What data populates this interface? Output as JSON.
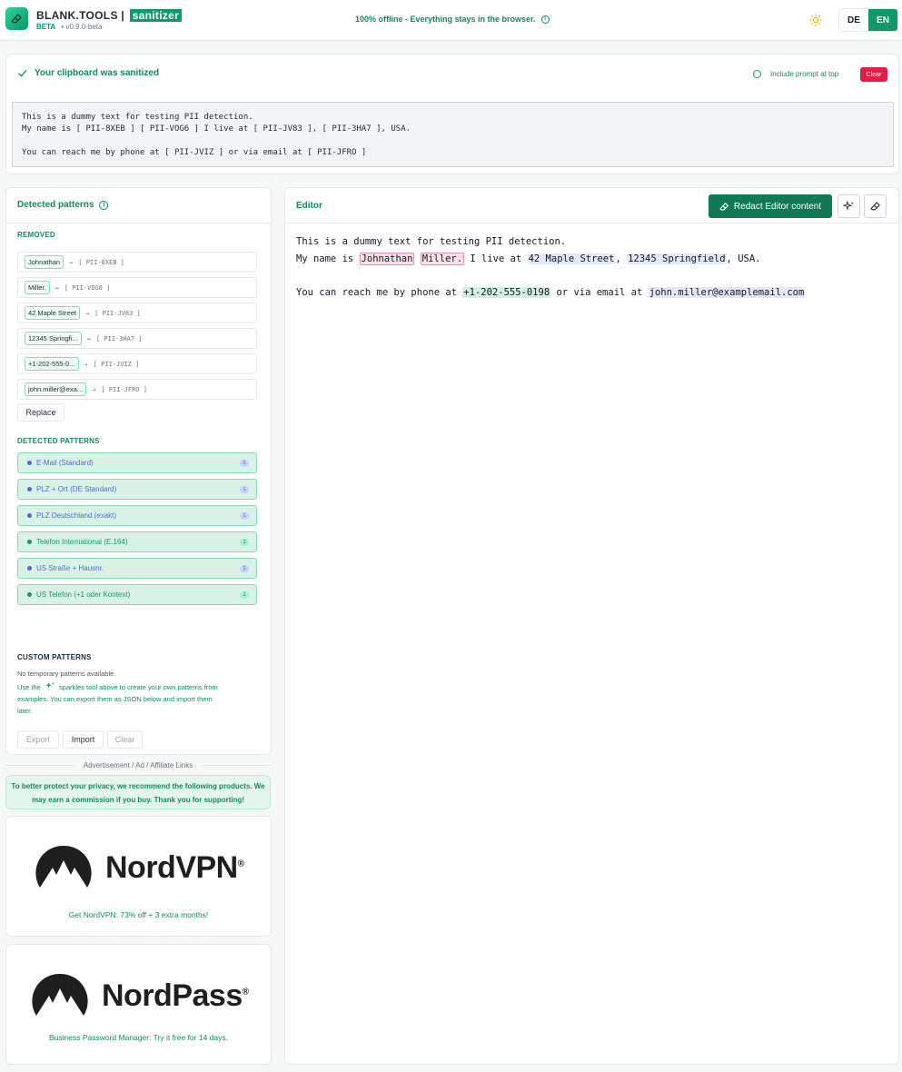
{
  "header": {
    "brand_name": "BLANK.TOOLS",
    "brand_sep": "|",
    "brand_tag": "sanitizer",
    "beta": "BETA",
    "version": "• v0.9.0-beta",
    "offline_text": "100% offline - Everything stays in the browser.",
    "lang_de": "DE",
    "lang_en": "EN",
    "active_lang": "EN",
    "icons": {
      "logo": "eraser-icon",
      "theme": "sun-icon",
      "info": "info-icon"
    }
  },
  "sanitized": {
    "title": "Your clipboard was sanitized",
    "include_prompt_label": "Include prompt at top",
    "clear_label": "Clear",
    "text": "This is a dummy text for testing PII detection.\nMy name is [ PII-8XEB ] [ PII-VOG6 ] I live at [ PII-JV83 ], [ PII-3HA7 ], USA.\n\nYou can reach me by phone at [ PII-JVIZ ] or via email at [ PII-JFRO ]"
  },
  "detected_panel": {
    "title": "Detected patterns",
    "removed_label": "REMOVED",
    "removed": [
      {
        "original": "Johnathan",
        "token": "[ PII-8XEB ]"
      },
      {
        "original": "Miller.",
        "token": "[ PII-VOG6 ]"
      },
      {
        "original": "42 Maple Street",
        "token": "[ PII-JV83 ]"
      },
      {
        "original": "12345 Springfi...",
        "token": "[ PII-3HA7 ]"
      },
      {
        "original": "+1-202-555-0...",
        "token": "[ PII-JVIZ ]"
      },
      {
        "original": "john.miller@exa...",
        "token": "[ PII-JFRO ]"
      }
    ],
    "replace_label": "Replace",
    "detected_label": "DETECTED PATTERNS",
    "patterns": [
      {
        "label": "E-Mail (Standard)",
        "count": "1",
        "color": "#4f6bd6"
      },
      {
        "label": "PLZ + Ort (DE Standard)",
        "count": "1",
        "color": "#4f6bd6"
      },
      {
        "label": "PLZ Deutschland (exakt)",
        "count": "1",
        "color": "#4f6bd6"
      },
      {
        "label": "Telefon International (E.164)",
        "count": "1",
        "color": "#10996b"
      },
      {
        "label": "US Straße + Hausnr.",
        "count": "1",
        "color": "#4f6bd6"
      },
      {
        "label": "US Telefon (+1 oder Kontext)",
        "count": "1",
        "color": "#10996b"
      }
    ],
    "custom_label": "CUSTOM PATTERNS",
    "custom_empty": "No temporary patterns available.",
    "custom_help_1": "Use the",
    "custom_help_2": "sparkles tool above to create your own patterns from",
    "custom_help_3": "examples. You can export them as JSON below and import them",
    "custom_help_4": "later.",
    "export_label": "Export",
    "import_label": "Import",
    "clear_label": "Clear"
  },
  "ads": {
    "label": "Advertisement / Ad / Affiliate Links",
    "note_line1": "To better protect your privacy, we recommend the following products. We",
    "note_line2": "may earn a commission if you buy. Thank you for supporting!",
    "nordvpn_name": "NordVPN",
    "nordvpn_text": "Get NordVPN: 73% off + 3 extra months!",
    "nordpass_name": "NordPass",
    "nordpass_text": "Business Password Manager: Try it free for 14 days.",
    "reg_mark": "®"
  },
  "editor": {
    "title": "Editor",
    "redact_label": "Redact Editor content",
    "line1": "This is a dummy text for testing PII detection.",
    "line2_a": "My name is ",
    "name1": "Johnathan",
    "name2": "Miller.",
    "line2_b": " I live at ",
    "street": "42 Maple Street",
    "comma1": ", ",
    "city": "12345 Springfield",
    "line2_c": ", USA.",
    "line4_a": "You can reach me by phone at ",
    "phone": "+1-202-555-0198",
    "line4_b": " or via email at ",
    "email": "john.miller@examplemail.com"
  }
}
